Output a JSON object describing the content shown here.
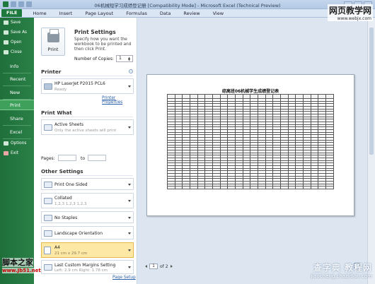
{
  "window": {
    "title": "06机械短学习成绩登记册 [Compatibility Mode] - Microsoft Excel (Technical Preview)"
  },
  "ribbon": {
    "file_tab": "FILE",
    "tabs": [
      "Home",
      "Insert",
      "Page Layout",
      "Formulas",
      "Data",
      "Review",
      "View"
    ]
  },
  "nav": {
    "top_items": [
      "Save",
      "Save As",
      "Open",
      "Close"
    ],
    "main_items": [
      "Info",
      "Recent",
      "New",
      "Print",
      "Share",
      "Excel"
    ],
    "bottom_items": [
      "Options",
      "Exit"
    ],
    "selected": "Print"
  },
  "print": {
    "button_label": "Print",
    "heading": "Print Settings",
    "description": "Specify how you want the workbook to be printed and then click Print.",
    "copies_label": "Number of Copies:",
    "copies_value": "1"
  },
  "printer": {
    "heading": "Printer",
    "name": "HP LaserJet P2015 PCL6",
    "status": "Ready",
    "properties_link": "Printer Properties"
  },
  "print_what": {
    "heading": "Print What",
    "title": "Active Sheets",
    "subtitle": "Only the active sheets will print",
    "pages_label": "Pages:",
    "to_label": "to"
  },
  "other_settings": {
    "heading": "Other Settings",
    "sides": "Print One Sided",
    "collation_title": "Collated",
    "collation_sub": "1,2,3   1,2,3   1,2,3",
    "staples": "No Staples",
    "orientation": "Landscape Orientation",
    "paper_title": "A4",
    "paper_sub": "21 cm x 29.7 cm",
    "margins_title": "Last Custom Margins Setting",
    "margins_sub": "Left: 2.9 cm    Right: 1.78 cm",
    "page_setup_link": "Page Setup"
  },
  "preview": {
    "sheet_title": "综高班06机械学生成绩登记表",
    "page_current": "1",
    "page_of": "of 2"
  },
  "watermarks": {
    "top_right_a": "网页教学网",
    "top_right_b": "www.webjx.com",
    "bottom_left_a": "脚本之家",
    "bottom_left_b": "www.Jb51.net",
    "bottom_right_a": "查字典 教程网",
    "bottom_right_b": "jiaocheng.chazidian.com"
  }
}
